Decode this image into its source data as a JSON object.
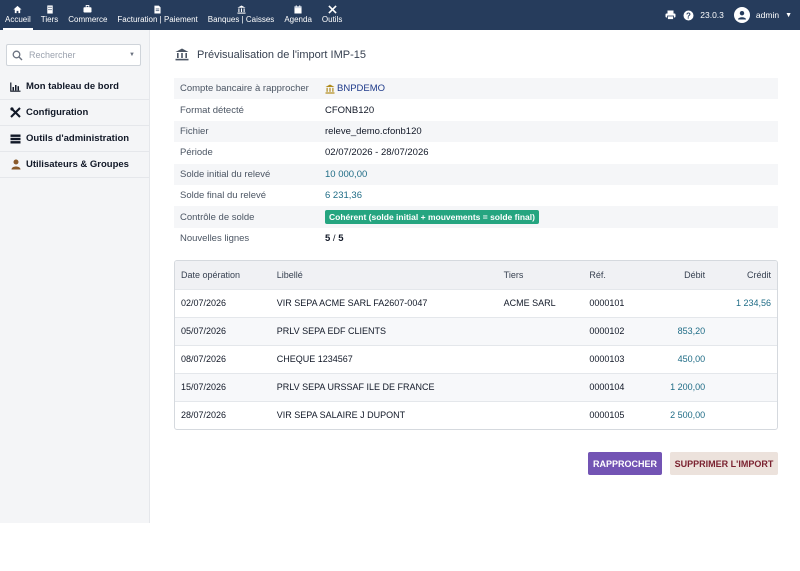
{
  "topbar": {
    "menu": [
      {
        "label": "Accueil",
        "icon": "home-icon"
      },
      {
        "label": "Tiers",
        "icon": "building-icon"
      },
      {
        "label": "Commerce",
        "icon": "briefcase-icon"
      },
      {
        "label": "Facturation | Paiement",
        "icon": "invoice-icon"
      },
      {
        "label": "Banques | Caisses",
        "icon": "bank-icon"
      },
      {
        "label": "Agenda",
        "icon": "calendar-icon"
      },
      {
        "label": "Outils",
        "icon": "tools-icon"
      }
    ],
    "version": "23.0.3",
    "user": "admin"
  },
  "sidebar": {
    "search_placeholder": "Rechercher",
    "items": [
      {
        "label": "Mon tableau de bord",
        "icon": "chart-icon"
      },
      {
        "label": "Configuration",
        "icon": "wrench-icon"
      },
      {
        "label": "Outils d'administration",
        "icon": "server-icon"
      },
      {
        "label": "Utilisateurs & Groupes",
        "icon": "user-icon"
      }
    ]
  },
  "page": {
    "title": "Prévisualisation de l'import IMP-15"
  },
  "info": {
    "bank_account_label": "Compte bancaire à rapprocher",
    "bank_account_value": "BNPDEMO",
    "format_label": "Format détecté",
    "format_value": "CFONB120",
    "file_label": "Fichier",
    "file_value": "releve_demo.cfonb120",
    "period_label": "Période",
    "period_value": "02/07/2026 - 28/07/2026",
    "initial_balance_label": "Solde initial du relevé",
    "initial_balance_value": "10 000,00",
    "final_balance_label": "Solde final du relevé",
    "final_balance_value": "6 231,36",
    "check_label": "Contrôle de solde",
    "check_value": "Cohérent (solde initial + mouvements = solde final)",
    "new_lines_label": "Nouvelles lignes",
    "new_lines_count": "5",
    "new_lines_sep": " / ",
    "new_lines_total": "5"
  },
  "table": {
    "headers": {
      "date": "Date opération",
      "label": "Libellé",
      "tiers": "Tiers",
      "ref": "Réf.",
      "debit": "Débit",
      "credit": "Crédit"
    },
    "rows": [
      {
        "date": "02/07/2026",
        "label": "VIR SEPA ACME SARL FA2607-0047",
        "tiers": "ACME SARL",
        "ref": "0000101",
        "debit": "",
        "credit": "1 234,56"
      },
      {
        "date": "05/07/2026",
        "label": "PRLV SEPA EDF CLIENTS",
        "tiers": "",
        "ref": "0000102",
        "debit": "853,20",
        "credit": ""
      },
      {
        "date": "08/07/2026",
        "label": "CHEQUE 1234567",
        "tiers": "",
        "ref": "0000103",
        "debit": "450,00",
        "credit": ""
      },
      {
        "date": "15/07/2026",
        "label": "PRLV SEPA URSSAF ILE DE FRANCE",
        "tiers": "",
        "ref": "0000104",
        "debit": "1 200,00",
        "credit": ""
      },
      {
        "date": "28/07/2026",
        "label": "VIR SEPA SALAIRE J DUPONT",
        "tiers": "",
        "ref": "0000105",
        "debit": "2 500,00",
        "credit": ""
      }
    ]
  },
  "actions": {
    "reconcile": "Rapprocher",
    "delete_import": "Supprimer l'import"
  },
  "colors": {
    "topbar": "#263c5c",
    "primary_button": "#7354b4",
    "badge_success": "#25a580",
    "amount": "#1f6c86"
  }
}
